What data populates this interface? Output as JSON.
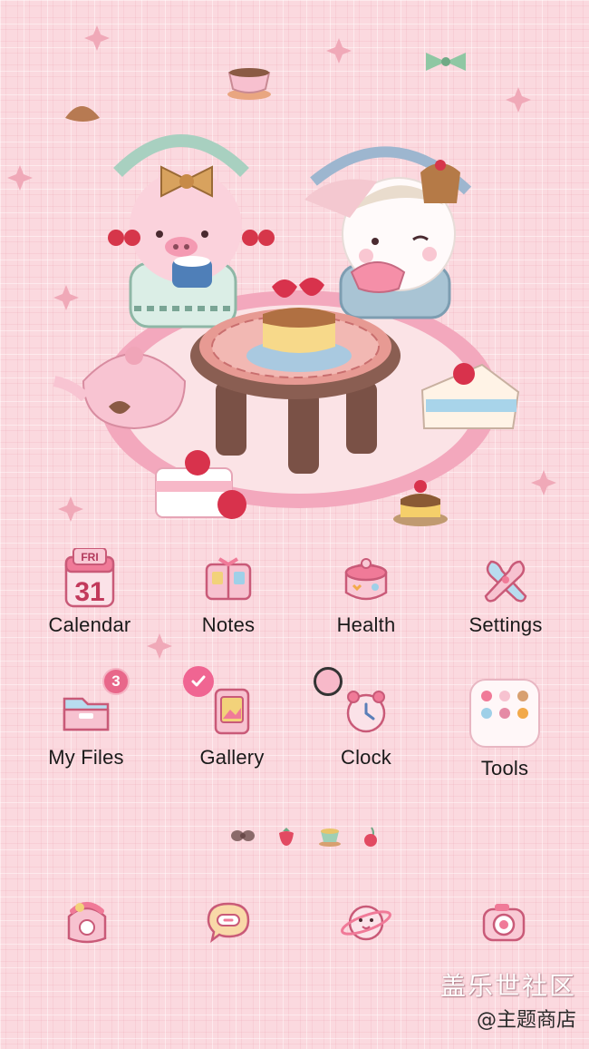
{
  "apps": [
    {
      "name": "Calendar",
      "icon": "calendar-icon",
      "day": "FRI",
      "date": "31"
    },
    {
      "name": "Notes",
      "icon": "notes-icon"
    },
    {
      "name": "Health",
      "icon": "health-icon"
    },
    {
      "name": "Settings",
      "icon": "settings-icon"
    },
    {
      "name": "My Files",
      "icon": "folder-files-icon",
      "badge": "3"
    },
    {
      "name": "Gallery",
      "icon": "gallery-icon"
    },
    {
      "name": "Clock",
      "icon": "clock-icon"
    },
    {
      "name": "Tools",
      "icon": "tools-folder-icon"
    }
  ],
  "dock": [
    {
      "icon": "phone-icon"
    },
    {
      "icon": "messages-icon"
    },
    {
      "icon": "internet-planet-icon"
    },
    {
      "icon": "camera-icon"
    }
  ],
  "pager_icons": [
    "bow-icon",
    "strawberry-icon",
    "teacup-icon",
    "cherry-icon"
  ],
  "watermark": {
    "line1": "盖乐世社区",
    "line2": "@主题商店"
  },
  "colors": {
    "background": "#fbd9df",
    "accent_pink": "#f06592",
    "badge": "#e8678a"
  }
}
